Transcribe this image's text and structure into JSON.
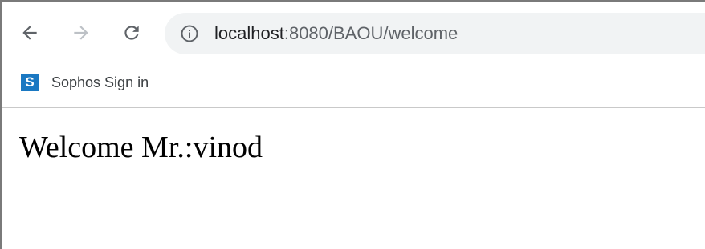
{
  "browser": {
    "url_host": "localhost",
    "url_rest": ":8080/BAOU/welcome",
    "nav": {
      "back_icon": "arrow-left-icon",
      "forward_icon": "arrow-right-icon",
      "reload_icon": "reload-icon",
      "site_info_icon": "info-icon"
    }
  },
  "bookmarks": [
    {
      "icon_letter": "S",
      "icon_color": "#1a78c2",
      "label": "Sophos Sign in"
    }
  ],
  "page": {
    "welcome_text": "Welcome Mr.:vinod"
  }
}
